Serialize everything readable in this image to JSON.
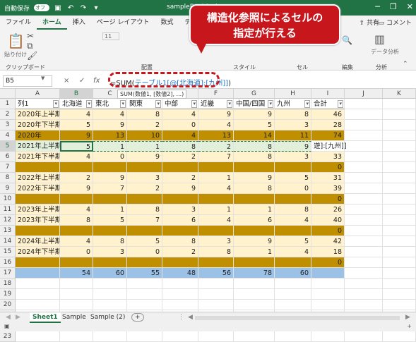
{
  "titlebar": {
    "autosave_label": "自動保存",
    "toggle_label": "オフ",
    "filename": "sampleBook1.xlsx",
    "undo_icon": "undo-icon",
    "redo_icon": "redo-icon"
  },
  "menubar": {
    "tabs": [
      "ファイル",
      "ホーム",
      "挿入",
      "ページ レイアウト",
      "数式",
      "データ",
      "校閲"
    ],
    "active": "ホーム",
    "share": "共有",
    "comment": "コメント"
  },
  "ribbon": {
    "groups": {
      "clipboard": "クリップボード",
      "paste": "貼り付け",
      "font_size": "11",
      "style": "配置",
      "styles": "スタイル",
      "cells": "セル",
      "edit": "編集",
      "analysis": "分析",
      "data_analysis": "データ分析"
    }
  },
  "formula_bar": {
    "name_box": "B5",
    "cancel": "×",
    "enter": "✓",
    "fx": "fx",
    "formula_prefix": "=SUM(",
    "formula_ref": "テーブル1[@[北海道]:[九州]]",
    "formula_suffix": ")",
    "tooltip": "SUM(数値1, [数値2], ...)"
  },
  "callout": {
    "line1": "構造化参照によるセルの",
    "line2": "指定が行える"
  },
  "columns": [
    "A",
    "B",
    "C",
    "D",
    "E",
    "F",
    "G",
    "H",
    "I",
    "J",
    "K"
  ],
  "header_row": [
    "列1",
    "北海道",
    "東北",
    "関東",
    "中部",
    "近畿",
    "中国/四国",
    "九州",
    "合計"
  ],
  "rows": [
    {
      "n": "2",
      "label": "2020年上半期",
      "vals": [
        "4",
        "4",
        "8",
        "4",
        "9",
        "9",
        "8",
        "46"
      ],
      "style": "light"
    },
    {
      "n": "3",
      "label": "2020年下半期",
      "vals": [
        "5",
        "9",
        "2",
        "0",
        "4",
        "5",
        "3",
        "28"
      ],
      "style": "light"
    },
    {
      "n": "4",
      "label": "2020年",
      "vals": [
        "9",
        "13",
        "10",
        "4",
        "13",
        "14",
        "11",
        "74"
      ],
      "style": "dark"
    },
    {
      "n": "5",
      "label": "2021年上半期",
      "vals": [
        "5",
        "1",
        "1",
        "8",
        "2",
        "8",
        "9",
        "遊]:[九州]]"
      ],
      "style": "selected"
    },
    {
      "n": "6",
      "label": "2021年下半期",
      "vals": [
        "4",
        "0",
        "9",
        "2",
        "7",
        "8",
        "3",
        "33"
      ],
      "style": "light"
    },
    {
      "n": "7",
      "label": "",
      "vals": [
        "",
        "",
        "",
        "",
        "",
        "",
        "",
        "0"
      ],
      "style": "dark"
    },
    {
      "n": "8",
      "label": "2022年上半期",
      "vals": [
        "2",
        "9",
        "3",
        "2",
        "1",
        "9",
        "5",
        "31"
      ],
      "style": "light"
    },
    {
      "n": "9",
      "label": "2022年下半期",
      "vals": [
        "9",
        "7",
        "2",
        "9",
        "4",
        "8",
        "0",
        "39"
      ],
      "style": "light"
    },
    {
      "n": "10",
      "label": "",
      "vals": [
        "",
        "",
        "",
        "",
        "",
        "",
        "",
        "0"
      ],
      "style": "dark"
    },
    {
      "n": "11",
      "label": "2023年上半期",
      "vals": [
        "4",
        "1",
        "8",
        "3",
        "1",
        "1",
        "8",
        "26"
      ],
      "style": "light"
    },
    {
      "n": "12",
      "label": "2023年下半期",
      "vals": [
        "8",
        "5",
        "7",
        "6",
        "4",
        "6",
        "4",
        "40"
      ],
      "style": "light"
    },
    {
      "n": "13",
      "label": "",
      "vals": [
        "",
        "",
        "",
        "",
        "",
        "",
        "",
        "0"
      ],
      "style": "dark"
    },
    {
      "n": "14",
      "label": "2024年上半期",
      "vals": [
        "4",
        "8",
        "5",
        "8",
        "3",
        "9",
        "5",
        "42"
      ],
      "style": "light"
    },
    {
      "n": "15",
      "label": "2024年下半期",
      "vals": [
        "0",
        "3",
        "0",
        "2",
        "8",
        "1",
        "4",
        "18"
      ],
      "style": "light"
    },
    {
      "n": "16",
      "label": "",
      "vals": [
        "",
        "",
        "",
        "",
        "",
        "",
        "",
        "0"
      ],
      "style": "dark"
    },
    {
      "n": "17",
      "label": "",
      "vals": [
        "54",
        "60",
        "55",
        "48",
        "56",
        "78",
        "60",
        ""
      ],
      "style": "total"
    },
    {
      "n": "18",
      "label": "",
      "vals": [
        "",
        "",
        "",
        "",
        "",
        "",
        "",
        ""
      ],
      "style": "empty"
    },
    {
      "n": "19",
      "label": "",
      "vals": [
        "",
        "",
        "",
        "",
        "",
        "",
        "",
        ""
      ],
      "style": "empty"
    },
    {
      "n": "20",
      "label": "",
      "vals": [
        "",
        "",
        "",
        "",
        "",
        "",
        "",
        ""
      ],
      "style": "empty"
    },
    {
      "n": "21",
      "label": "",
      "vals": [
        "",
        "",
        "",
        "",
        "",
        "",
        "",
        ""
      ],
      "style": "empty"
    },
    {
      "n": "22",
      "label": "",
      "vals": [
        "",
        "",
        "",
        "",
        "",
        "",
        "",
        ""
      ],
      "style": "empty"
    },
    {
      "n": "23",
      "label": "",
      "vals": [
        "",
        "",
        "",
        "",
        "",
        "",
        "",
        ""
      ],
      "style": "empty"
    }
  ],
  "colors": {
    "light": "#fff2cc",
    "dark": "#bf8f00",
    "selected": "#e2efda",
    "total": "#9bc2e6",
    "header_row": "#ffffff"
  },
  "sheets": [
    "Sheet1",
    "Sample",
    "Sample (2)"
  ],
  "active_sheet": "Sheet1",
  "add_sheet": "+"
}
